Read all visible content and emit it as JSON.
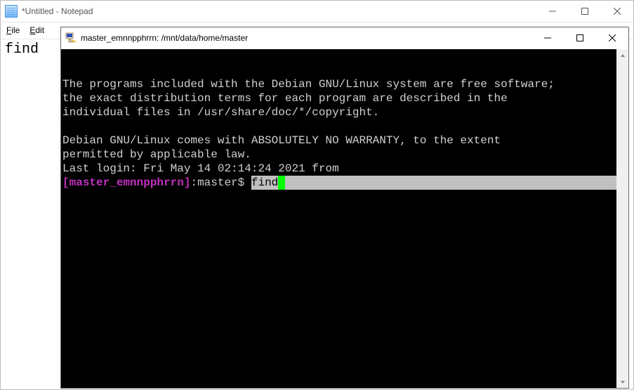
{
  "notepad": {
    "title": "*Untitled - Notepad",
    "menu": {
      "file": "File",
      "edit": "Edit"
    },
    "body_text": "find"
  },
  "putty": {
    "title": "master_emnnpphrrn: /mnt/data/home/master",
    "motd_line1": "The programs included with the Debian GNU/Linux system are free software;",
    "motd_line2": "the exact distribution terms for each program are described in the",
    "motd_line3": "individual files in /usr/share/doc/*/copyright.",
    "motd_line4": "Debian GNU/Linux comes with ABSOLUTELY NO WARRANTY, to the extent",
    "motd_line5": "permitted by applicable law.",
    "last_login": "Last login: Fri May 14 02:14:24 2021 from",
    "prompt_bracket_open": "[",
    "prompt_user": "master_emnnpphrrn",
    "prompt_bracket_close": "]",
    "prompt_sep": ":",
    "prompt_path": "master",
    "prompt_dollar": "$ ",
    "command": "find"
  }
}
